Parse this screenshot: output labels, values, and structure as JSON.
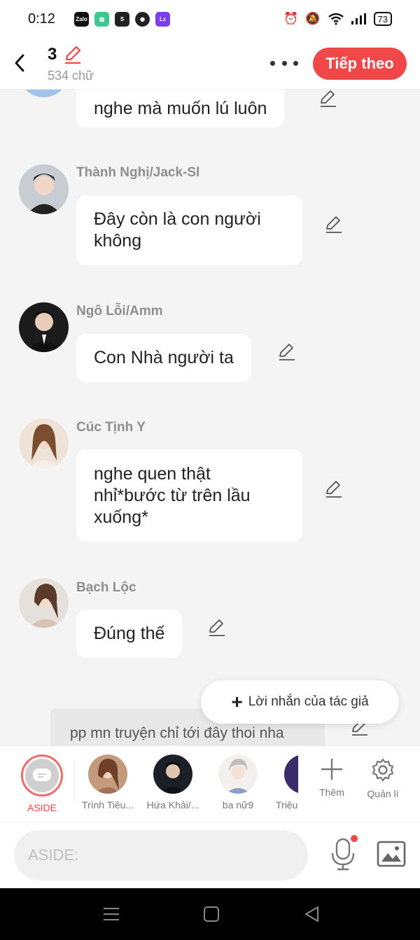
{
  "status": {
    "time": "0:12",
    "battery": "73",
    "apps": [
      {
        "name": "Zalo",
        "color": "#0068ff"
      },
      {
        "name": "messages",
        "color": "#3cc98f"
      },
      {
        "name": "shopee",
        "color": "#222222"
      },
      {
        "name": "chrome",
        "color": "#222222"
      },
      {
        "name": "lazada",
        "color": "#ff6600"
      }
    ]
  },
  "header": {
    "chapter_number": "3",
    "word_count": "534 chữ",
    "next_label": "Tiếp theo"
  },
  "messages": [
    {
      "name": "",
      "text": "nghe mà muốn lú luôn",
      "avatar_color": "#9fc4e8"
    },
    {
      "name": "Thành Nghị/Jack-Sl",
      "text": "Đây còn là con người không",
      "avatar_color": "#b9bdc6"
    },
    {
      "name": "Ngô Lỗi/Amm",
      "text": "Con Nhà người ta",
      "avatar_color": "#2a2a2a"
    },
    {
      "name": "Cúc Tịnh Y",
      "text": "nghe quen thật nhỉ*bước từ trên lầu xuống*",
      "avatar_color": "#e7c9b6"
    },
    {
      "name": "Bạch Lộc",
      "text": "Đúng thế",
      "avatar_color": "#d8b7a4"
    }
  ],
  "author_message": "pp mn truyện chỉ tới đây thoi nha",
  "author_note_button": "Lời nhắn của tác giả",
  "characters": [
    {
      "label": "ASIDE"
    },
    {
      "label": "Trình Tiêu...",
      "avatar_color": "#b0866d"
    },
    {
      "label": "Hứa Khải/...",
      "avatar_color": "#1c2026"
    },
    {
      "label": "ba nữ9",
      "avatar_color": "#e8e2dd"
    },
    {
      "label": "Triệu",
      "avatar_color": "#3a2b6b"
    }
  ],
  "tools": {
    "add_label": "Thêm",
    "manage_label": "Quản lí"
  },
  "input": {
    "placeholder": "ASIDE:"
  }
}
